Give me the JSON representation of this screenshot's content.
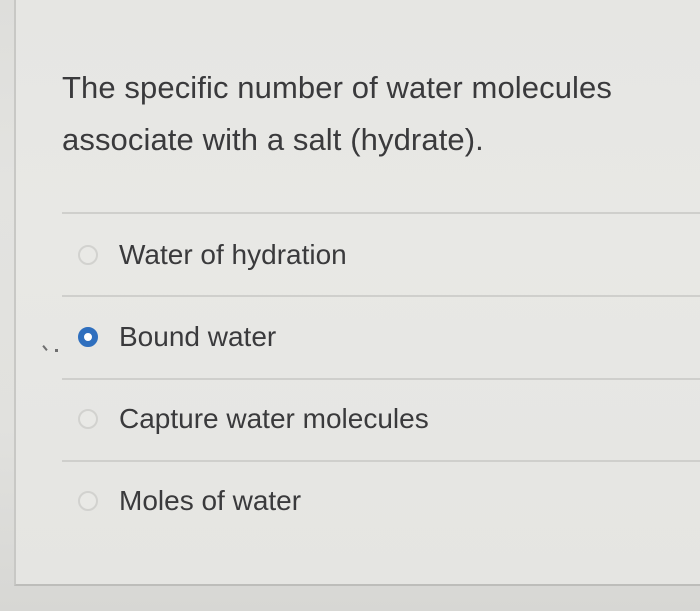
{
  "question": {
    "text": "The specific number of water molecules associate with a salt (hydrate)."
  },
  "options": [
    {
      "label": "Water of hydration",
      "selected": false
    },
    {
      "label": "Bound water",
      "selected": true
    },
    {
      "label": "Capture water molecules",
      "selected": false
    },
    {
      "label": "Moles of water",
      "selected": false
    }
  ],
  "colors": {
    "accent": "#2f6fbe",
    "text": "#3a3a3c",
    "divider": "#cfcfcc"
  }
}
